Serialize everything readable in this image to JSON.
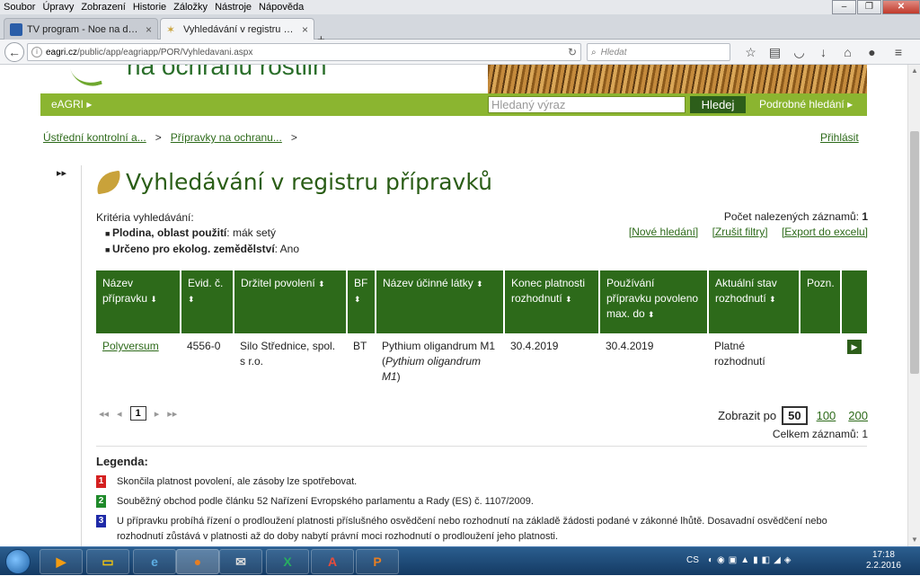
{
  "menu": [
    "Soubor",
    "Úpravy",
    "Zobrazení",
    "Historie",
    "Záložky",
    "Nástroje",
    "Nápověda"
  ],
  "tabs": [
    {
      "title": "TV program - Noe na dnes ...",
      "close": "×"
    },
    {
      "title": "Vyhledávání v registru příp...",
      "close": "×"
    }
  ],
  "nav": {
    "url_host": "eagri.cz",
    "url_path": "/public/app/eagriapp/POR/Vyhledavani.aspx",
    "search_placeholder": "Hledat"
  },
  "site": {
    "banner_title": "na ochranu rostlin",
    "eagri_label": "eAGRI ▸",
    "search_placeholder": "Hledaný výraz",
    "search_button": "Hledej",
    "advanced_search": "Podrobné hledání ▸"
  },
  "breadcrumb": {
    "item1": "Ústřední kontrolní a...",
    "sep1": ">",
    "item2": "Přípravky na ochranu...",
    "sep2": ">"
  },
  "login": "Přihlásit",
  "expander": "▸▸",
  "page_title": "Vyhledávání v registru přípravků",
  "criteria": {
    "heading": "Kritéria vyhledávání:",
    "c1_label": "Plodina, oblast použití",
    "c1_value": ": mák setý",
    "c2_label": "Určeno pro ekolog. zemědělství",
    "c2_value": ": Ano"
  },
  "results": {
    "count_label": "Počet nalezených záznamů:",
    "count_value": "1",
    "new_search": "[Nové hledání]",
    "cancel_filters": "[Zrušit filtry]",
    "export": "[Export do excelu]"
  },
  "table": {
    "headers": [
      "Název přípravku",
      "Evid. č.",
      "Držitel povolení",
      "BF",
      "Název účinné látky",
      "Konec platnosti rozhodnutí",
      "Používání přípravku povoleno max. do",
      "Aktuální stav rozhodnutí",
      "Pozn."
    ],
    "row": {
      "name": "Polyversum",
      "evid": "4556-0",
      "holder": "Silo Střednice, spol. s r.o.",
      "bf": "BT",
      "substance": "Pythium oligandrum M1 (",
      "substance_italic": "Pythium oligandrum M1",
      "substance_end": ")",
      "end_validity": "30.4.2019",
      "use_until": "30.4.2019",
      "status": "Platné rozhodnutí"
    }
  },
  "pager": {
    "first": "◂◂",
    "prev": "◂",
    "current": "1",
    "next": "▸",
    "last": "▸▸",
    "per_page_label": "Zobrazit po",
    "per_page_selected": "50",
    "per_page_opt1": "100",
    "per_page_opt2": "200",
    "total_label": "Celkem záznamů:",
    "total_value": "1"
  },
  "legend": {
    "title": "Legenda:",
    "items": [
      {
        "num": "1",
        "color": "#d42020",
        "text": "Skončila platnost povolení, ale zásoby lze spotřebovat."
      },
      {
        "num": "2",
        "color": "#1f8a2a",
        "text": "Souběžný obchod podle článku 52 Nařízení Evropského parlamentu a Rady (ES) č. 1107/2009."
      },
      {
        "num": "3",
        "color": "#1f2aa8",
        "text": "U přípravku probíhá řízení o prodloužení platnosti příslušného osvědčení nebo rozhodnutí na základě žádosti podané v zákonné lhůtě. Dosavadní osvědčení nebo rozhodnutí zůstává v platnosti až do doby nabytí právní moci rozhodnutí o prodloužení jeho platnosti."
      }
    ]
  },
  "taskbar": {
    "lang": "CS",
    "time": "17:18",
    "date": "2.2.2016"
  },
  "colors": {
    "accent_green": "#2d6a1a",
    "bar_green": "#8bb530"
  }
}
